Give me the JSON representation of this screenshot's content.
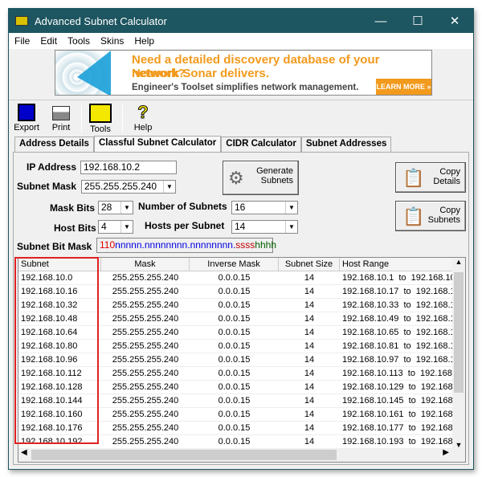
{
  "window": {
    "title": "Advanced Subnet Calculator",
    "minimize": "—",
    "maximize": "☐",
    "close": "✕"
  },
  "menu": [
    "File",
    "Edit",
    "Tools",
    "Skins",
    "Help"
  ],
  "banner": {
    "line1": "Need a detailed discovery database of your network?",
    "line2": "Network Sonar delivers.",
    "line3": "Engineer's Toolset simplifies network management.",
    "cta": "LEARN MORE »"
  },
  "toolbar": {
    "export": "Export",
    "print": "Print",
    "tools": "Tools",
    "help": "Help"
  },
  "tabs": [
    "Address Details",
    "Classful Subnet Calculator",
    "CIDR Calculator",
    "Subnet Addresses"
  ],
  "active_tab": "Classful Subnet Calculator",
  "form": {
    "ip_label": "IP Address",
    "ip_value": "192.168.10.2",
    "mask_label": "Subnet Mask",
    "mask_value": "255.255.255.240",
    "mask_bits_label": "Mask Bits",
    "mask_bits_value": "28",
    "host_bits_label": "Host Bits",
    "host_bits_value": "4",
    "num_subnets_label": "Number of Subnets",
    "num_subnets_value": "16",
    "hosts_label": "Hosts per Subnet",
    "hosts_value": "14",
    "bitmask_label": "Subnet Bit Mask",
    "bitmask": {
      "a": "110",
      "b": "nnnnn.nnnnnnnn.nnnnnnnn.",
      "c": "ssss",
      "d": "hhhh"
    }
  },
  "buttons": {
    "generate": "Generate Subnets",
    "copy_details": "Copy Details",
    "copy_subnets": "Copy Subnets"
  },
  "table": {
    "columns": [
      "Subnet",
      "Mask",
      "Inverse Mask",
      "Subnet Size",
      "Host Range"
    ],
    "rows": [
      [
        "192.168.10.0",
        "255.255.255.240",
        "0.0.0.15",
        "14",
        "192.168.10.1  to  192.168.10"
      ],
      [
        "192.168.10.16",
        "255.255.255.240",
        "0.0.0.15",
        "14",
        "192.168.10.17  to  192.168.1"
      ],
      [
        "192.168.10.32",
        "255.255.255.240",
        "0.0.0.15",
        "14",
        "192.168.10.33  to  192.168.1"
      ],
      [
        "192.168.10.48",
        "255.255.255.240",
        "0.0.0.15",
        "14",
        "192.168.10.49  to  192.168.1"
      ],
      [
        "192.168.10.64",
        "255.255.255.240",
        "0.0.0.15",
        "14",
        "192.168.10.65  to  192.168.1"
      ],
      [
        "192.168.10.80",
        "255.255.255.240",
        "0.0.0.15",
        "14",
        "192.168.10.81  to  192.168.1"
      ],
      [
        "192.168.10.96",
        "255.255.255.240",
        "0.0.0.15",
        "14",
        "192.168.10.97  to  192.168.1"
      ],
      [
        "192.168.10.112",
        "255.255.255.240",
        "0.0.0.15",
        "14",
        "192.168.10.113  to  192.168."
      ],
      [
        "192.168.10.128",
        "255.255.255.240",
        "0.0.0.15",
        "14",
        "192.168.10.129  to  192.168."
      ],
      [
        "192.168.10.144",
        "255.255.255.240",
        "0.0.0.15",
        "14",
        "192.168.10.145  to  192.168."
      ],
      [
        "192.168.10.160",
        "255.255.255.240",
        "0.0.0.15",
        "14",
        "192.168.10.161  to  192.168."
      ],
      [
        "192.168.10.176",
        "255.255.255.240",
        "0.0.0.15",
        "14",
        "192.168.10.177  to  192.168."
      ],
      [
        "192.168.10.192",
        "255.255.255.240",
        "0.0.0.15",
        "14",
        "192.168.10.193  to  192.168."
      ]
    ]
  },
  "colors": {
    "titlebar": "#1d5560",
    "banner_accent": "#f29a1c",
    "highlight": "#e02020",
    "bits_network_class": "#e00000",
    "bits_network": "#0000e0",
    "bits_subnet": "#c00000",
    "bits_host": "#006000"
  }
}
